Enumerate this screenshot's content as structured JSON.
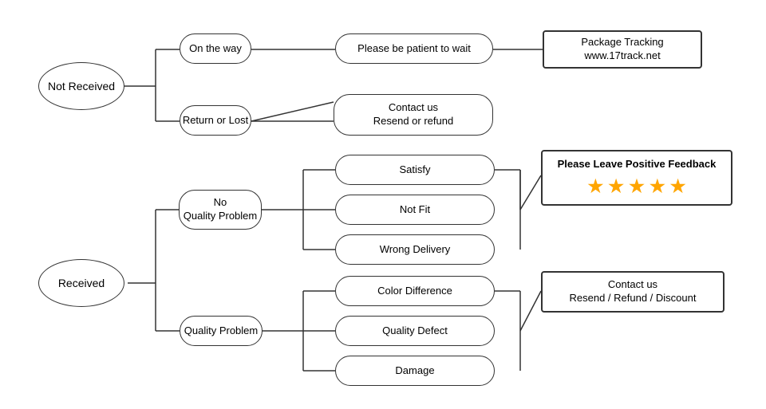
{
  "nodes": {
    "not_received": "Not\nReceived",
    "received": "Received",
    "on_the_way": "On the way",
    "return_or_lost": "Return or Lost",
    "patient_wait": "Please be patient to wait",
    "contact_resend": "Contact us\nResend or refund",
    "package_tracking": "Package Tracking\nwww.17track.net",
    "no_quality_problem": "No\nQuality Problem",
    "quality_problem": "Quality Problem",
    "satisfy": "Satisfy",
    "not_fit": "Not Fit",
    "wrong_delivery": "Wrong Delivery",
    "color_difference": "Color Difference",
    "quality_defect": "Quality Defect",
    "damage": "Damage",
    "please_feedback": "Please Leave Positive Feedback",
    "stars": "★ ★ ★ ★ ★",
    "contact_refund": "Contact us\nResend / Refund / Discount"
  },
  "colors": {
    "star": "#FFA500",
    "border": "#333333"
  }
}
